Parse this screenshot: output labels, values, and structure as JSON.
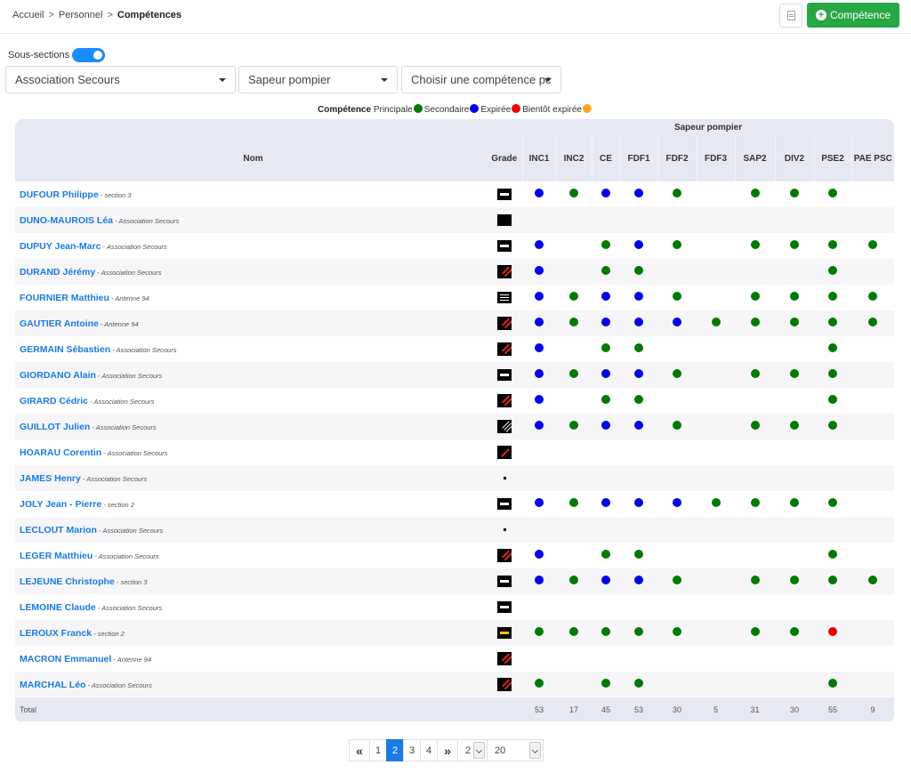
{
  "breadcrumb": {
    "home": "Accueil",
    "section": "Personnel",
    "current": "Compétences"
  },
  "toolbar": {
    "add_label": "Compétence"
  },
  "filters": {
    "subsections_label": "Sous-sections",
    "subsections_on": true,
    "association": "Association Secours",
    "role": "Sapeur pompier",
    "competence_placeholder": "Choisir une compétence pc"
  },
  "legend": {
    "title": "Compétence",
    "principale": "Principale",
    "secondaire": "Secondaire",
    "expiree": "Expirée",
    "bientot": "Bientôt expirée",
    "colors": {
      "principale": "#007a00",
      "secondaire": "#0000ee",
      "expiree": "#ee0000",
      "bientot": "#f5a623"
    }
  },
  "table": {
    "group_header": "Sapeur pompier",
    "name_header": "Nom",
    "grade_header": "Grade",
    "skills": [
      "INC1",
      "INC2",
      "CE",
      "FDF1",
      "FDF2",
      "FDF3",
      "SAP2",
      "DIV2",
      "PSE2",
      "PAE PSC"
    ],
    "rows": [
      {
        "name": "DUFOUR Philippe",
        "section": "section 3",
        "grade": "mid",
        "cells": [
          "b",
          "g",
          "b",
          "b",
          "g",
          "",
          "g",
          "g",
          "g",
          ""
        ]
      },
      {
        "name": "DUNO-MAUROIS Léa",
        "section": "Association Secours",
        "grade": "plain",
        "cells": [
          "",
          "",
          "",
          "",
          "",
          "",
          "",
          "",
          "",
          ""
        ]
      },
      {
        "name": "DUPUY Jean-Marc",
        "section": "Association Secours",
        "grade": "mid",
        "cells": [
          "b",
          "",
          "g",
          "b",
          "g",
          "",
          "g",
          "g",
          "g",
          "g"
        ]
      },
      {
        "name": "DURAND Jérémy",
        "section": "Association Secours",
        "grade": "red",
        "cells": [
          "b",
          "",
          "g",
          "g",
          "",
          "",
          "",
          "",
          "g",
          ""
        ]
      },
      {
        "name": "FOURNIER Matthieu",
        "section": "Antenne 94",
        "grade": "three",
        "cells": [
          "b",
          "g",
          "b",
          "b",
          "g",
          "",
          "g",
          "g",
          "g",
          "g"
        ]
      },
      {
        "name": "GAUTIER Antoine",
        "section": "Antenne 94",
        "grade": "red",
        "cells": [
          "b",
          "g",
          "b",
          "b",
          "b",
          "g",
          "g",
          "g",
          "g",
          "g"
        ]
      },
      {
        "name": "GERMAIN Sébastien",
        "section": "Association Secours",
        "grade": "red",
        "cells": [
          "b",
          "",
          "g",
          "g",
          "",
          "",
          "",
          "",
          "g",
          ""
        ]
      },
      {
        "name": "GIORDANO Alain",
        "section": "Association Secours",
        "grade": "mid",
        "cells": [
          "b",
          "g",
          "b",
          "b",
          "g",
          "",
          "g",
          "g",
          "g",
          ""
        ]
      },
      {
        "name": "GIRARD Cédric",
        "section": "Association Secours",
        "grade": "red",
        "cells": [
          "b",
          "",
          "g",
          "g",
          "",
          "",
          "",
          "",
          "g",
          ""
        ]
      },
      {
        "name": "GUILLOT Julien",
        "section": "Association Secours",
        "grade": "white",
        "cells": [
          "b",
          "g",
          "b",
          "b",
          "g",
          "",
          "g",
          "g",
          "g",
          ""
        ]
      },
      {
        "name": "HOARAU Corentin",
        "section": "Association Secours",
        "grade": "red1",
        "cells": [
          "",
          "",
          "",
          "",
          "",
          "",
          "",
          "",
          "",
          ""
        ]
      },
      {
        "name": "JAMES Henry",
        "section": "Association Secours",
        "grade": "dot",
        "cells": [
          "",
          "",
          "",
          "",
          "",
          "",
          "",
          "",
          "",
          ""
        ]
      },
      {
        "name": "JOLY Jean - Pierre",
        "section": "section 2",
        "grade": "mid",
        "cells": [
          "b",
          "g",
          "b",
          "b",
          "b",
          "g",
          "g",
          "g",
          "g",
          ""
        ]
      },
      {
        "name": "LECLOUT Marion",
        "section": "Association Secours",
        "grade": "dot",
        "cells": [
          "",
          "",
          "",
          "",
          "",
          "",
          "",
          "",
          "",
          ""
        ]
      },
      {
        "name": "LEGER Matthieu",
        "section": "Association Secours",
        "grade": "red",
        "cells": [
          "b",
          "",
          "g",
          "g",
          "",
          "",
          "",
          "",
          "g",
          ""
        ]
      },
      {
        "name": "LEJEUNE Christophe",
        "section": "section 3",
        "grade": "mid",
        "cells": [
          "b",
          "g",
          "b",
          "b",
          "g",
          "",
          "g",
          "g",
          "g",
          "g"
        ]
      },
      {
        "name": "LEMOINE Claude",
        "section": "Association Secours",
        "grade": "mid",
        "cells": [
          "",
          "",
          "",
          "",
          "",
          "",
          "",
          "",
          "",
          ""
        ]
      },
      {
        "name": "LEROUX Franck",
        "section": "section 2",
        "grade": "yellow",
        "cells": [
          "g",
          "g",
          "g",
          "g",
          "g",
          "",
          "g",
          "g",
          "r",
          ""
        ]
      },
      {
        "name": "MACRON Emmanuel",
        "section": "Antenne 94",
        "grade": "red",
        "cells": [
          "",
          "",
          "",
          "",
          "",
          "",
          "",
          "",
          "",
          ""
        ]
      },
      {
        "name": "MARCHAL Léo",
        "section": "Association Secours",
        "grade": "red",
        "cells": [
          "g",
          "",
          "g",
          "g",
          "",
          "",
          "",
          "",
          "g",
          ""
        ]
      }
    ],
    "total_label": "Total",
    "totals": [
      "53",
      "17",
      "45",
      "53",
      "30",
      "5",
      "31",
      "30",
      "55",
      "9"
    ]
  },
  "pagination": {
    "first": "«",
    "pages": [
      "1",
      "2",
      "3",
      "4"
    ],
    "current_page": "2",
    "last": "»",
    "page_select": "2",
    "page_size": "20"
  }
}
